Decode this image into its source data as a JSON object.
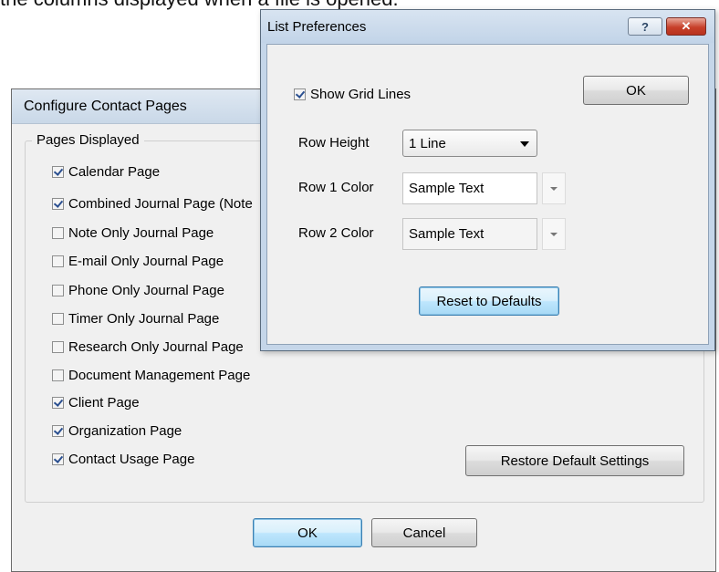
{
  "background": {
    "caption": "the columns displayed when a file is opened."
  },
  "configure_dialog": {
    "title": "Configure Contact Pages",
    "group_label": "Pages Displayed",
    "pages": [
      {
        "label": "Calendar Page",
        "checked": true
      },
      {
        "label": "Combined Journal Page (Note",
        "checked": true
      },
      {
        "label": "Note Only Journal Page",
        "checked": false
      },
      {
        "label": "E-mail Only Journal Page",
        "checked": false
      },
      {
        "label": "Phone Only Journal Page",
        "checked": false
      },
      {
        "label": "Timer Only Journal Page",
        "checked": false
      },
      {
        "label": "Research Only Journal Page",
        "checked": false
      },
      {
        "label": "Document Management Page",
        "checked": false
      },
      {
        "label": "Client Page",
        "checked": true
      },
      {
        "label": "Organization Page",
        "checked": true
      },
      {
        "label": "Contact Usage Page",
        "checked": true
      }
    ],
    "restore_label": "Restore Default Settings",
    "ok_label": "OK",
    "cancel_label": "Cancel"
  },
  "list_prefs_dialog": {
    "title": "List Preferences",
    "help_label": "?",
    "close_label": "✕",
    "show_grid_label": "Show Grid Lines",
    "show_grid_checked": true,
    "ok_label": "OK",
    "row_height_label": "Row Height",
    "row_height_value": "1 Line",
    "row1_color_label": "Row 1 Color",
    "row1_color_value": "Sample Text",
    "row2_color_label": "Row 2 Color",
    "row2_color_value": "Sample Text",
    "reset_label": "Reset to Defaults"
  }
}
